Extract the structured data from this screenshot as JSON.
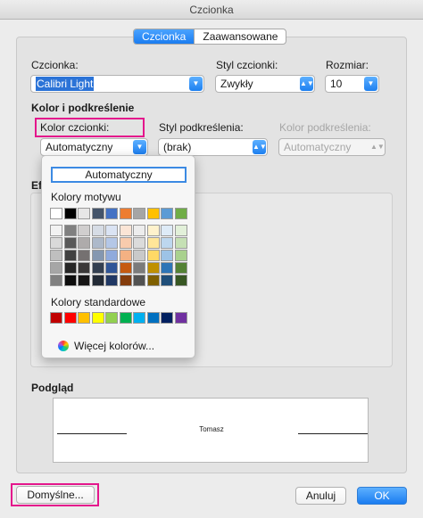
{
  "window": {
    "title": "Czcionka"
  },
  "tabs": [
    {
      "label": "Czcionka",
      "active": true
    },
    {
      "label": "Zaawansowane",
      "active": false
    }
  ],
  "font": {
    "font_label": "Czcionka:",
    "font_value": "Calibri Light",
    "style_label": "Styl czcionki:",
    "style_value": "Zwykły",
    "size_label": "Rozmiar:",
    "size_value": "10"
  },
  "color_section": {
    "title": "Kolor i podkreślenie",
    "color_label": "Kolor czcionki:",
    "color_value": "Automatyczny",
    "underline_style_label": "Styl podkreślenia:",
    "underline_style_value": "(brak)",
    "underline_color_label": "Kolor podkreślenia:",
    "underline_color_value": "Automatyczny"
  },
  "effects": {
    "title_partial": "Ef"
  },
  "popup": {
    "auto_label": "Automatyczny",
    "theme_label": "Kolory motywu",
    "standard_label": "Kolory standardowe",
    "more_label": "Więcej kolorów...",
    "theme_top": [
      "#ffffff",
      "#000000",
      "#e7e6e6",
      "#44546a",
      "#4472c4",
      "#ed7d31",
      "#a5a5a5",
      "#ffc000",
      "#5b9bd5",
      "#70ad47"
    ],
    "theme_shades": [
      [
        "#f2f2f2",
        "#808080",
        "#d0cece",
        "#d6dce5",
        "#dae3f3",
        "#fbe5d6",
        "#ededed",
        "#fff2cc",
        "#deebf7",
        "#e2f0d9"
      ],
      [
        "#d9d9d9",
        "#595959",
        "#aeabab",
        "#adb9ca",
        "#b4c7e7",
        "#f8cbad",
        "#dbdbdb",
        "#ffe699",
        "#bdd7ee",
        "#c5e0b4"
      ],
      [
        "#bfbfbf",
        "#404040",
        "#757171",
        "#8497b0",
        "#8faadc",
        "#f4b183",
        "#c9c9c9",
        "#ffd966",
        "#9dc3e6",
        "#a9d18e"
      ],
      [
        "#a6a6a6",
        "#262626",
        "#3a3838",
        "#333f50",
        "#2f5597",
        "#c55a11",
        "#7b7b7b",
        "#bf9000",
        "#2e75b6",
        "#548235"
      ],
      [
        "#808080",
        "#0d0d0d",
        "#171616",
        "#222a35",
        "#203864",
        "#843c0c",
        "#525252",
        "#7f6000",
        "#1f4e79",
        "#385723"
      ]
    ],
    "standard": [
      "#c00000",
      "#ff0000",
      "#ffc000",
      "#ffff00",
      "#92d050",
      "#00b050",
      "#00b0f0",
      "#0070c0",
      "#002060",
      "#7030a0"
    ]
  },
  "preview": {
    "title": "Podgląd",
    "sample_text": "Tomasz"
  },
  "buttons": {
    "default": "Domyślne...",
    "cancel": "Anuluj",
    "ok": "OK"
  }
}
